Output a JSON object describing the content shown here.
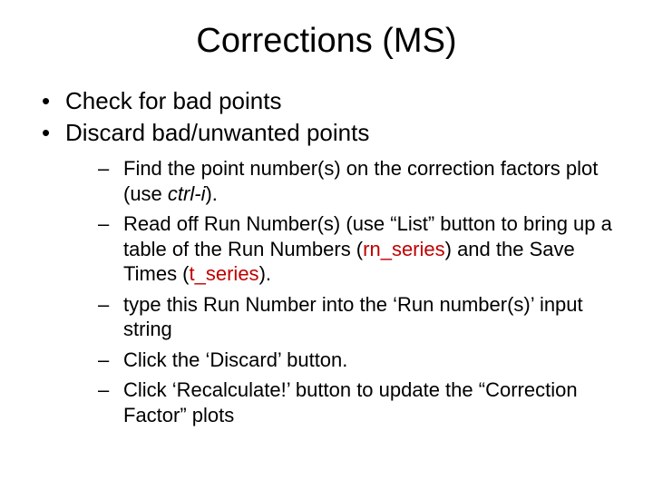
{
  "title": "Corrections (MS)",
  "bullets": {
    "b1": "Check for bad points",
    "b2": "Discard bad/unwanted points"
  },
  "sub": {
    "s1a": "Find the point number(s) on the correction factors plot (use ",
    "s1b": "ctrl-i",
    "s1c": ").",
    "s2a": "Read off Run Number(s) (use “List” button to bring up a table of the Run Numbers (",
    "s2b": "rn_series",
    "s2c": ") and the Save Times (",
    "s2d": "t_series",
    "s2e": ").",
    "s3": "type this Run Number into the ‘Run number(s)’ input string",
    "s4": "Click the ‘Discard’ button.",
    "s5": "Click ‘Recalculate!’ button to update the “Correction Factor” plots"
  }
}
